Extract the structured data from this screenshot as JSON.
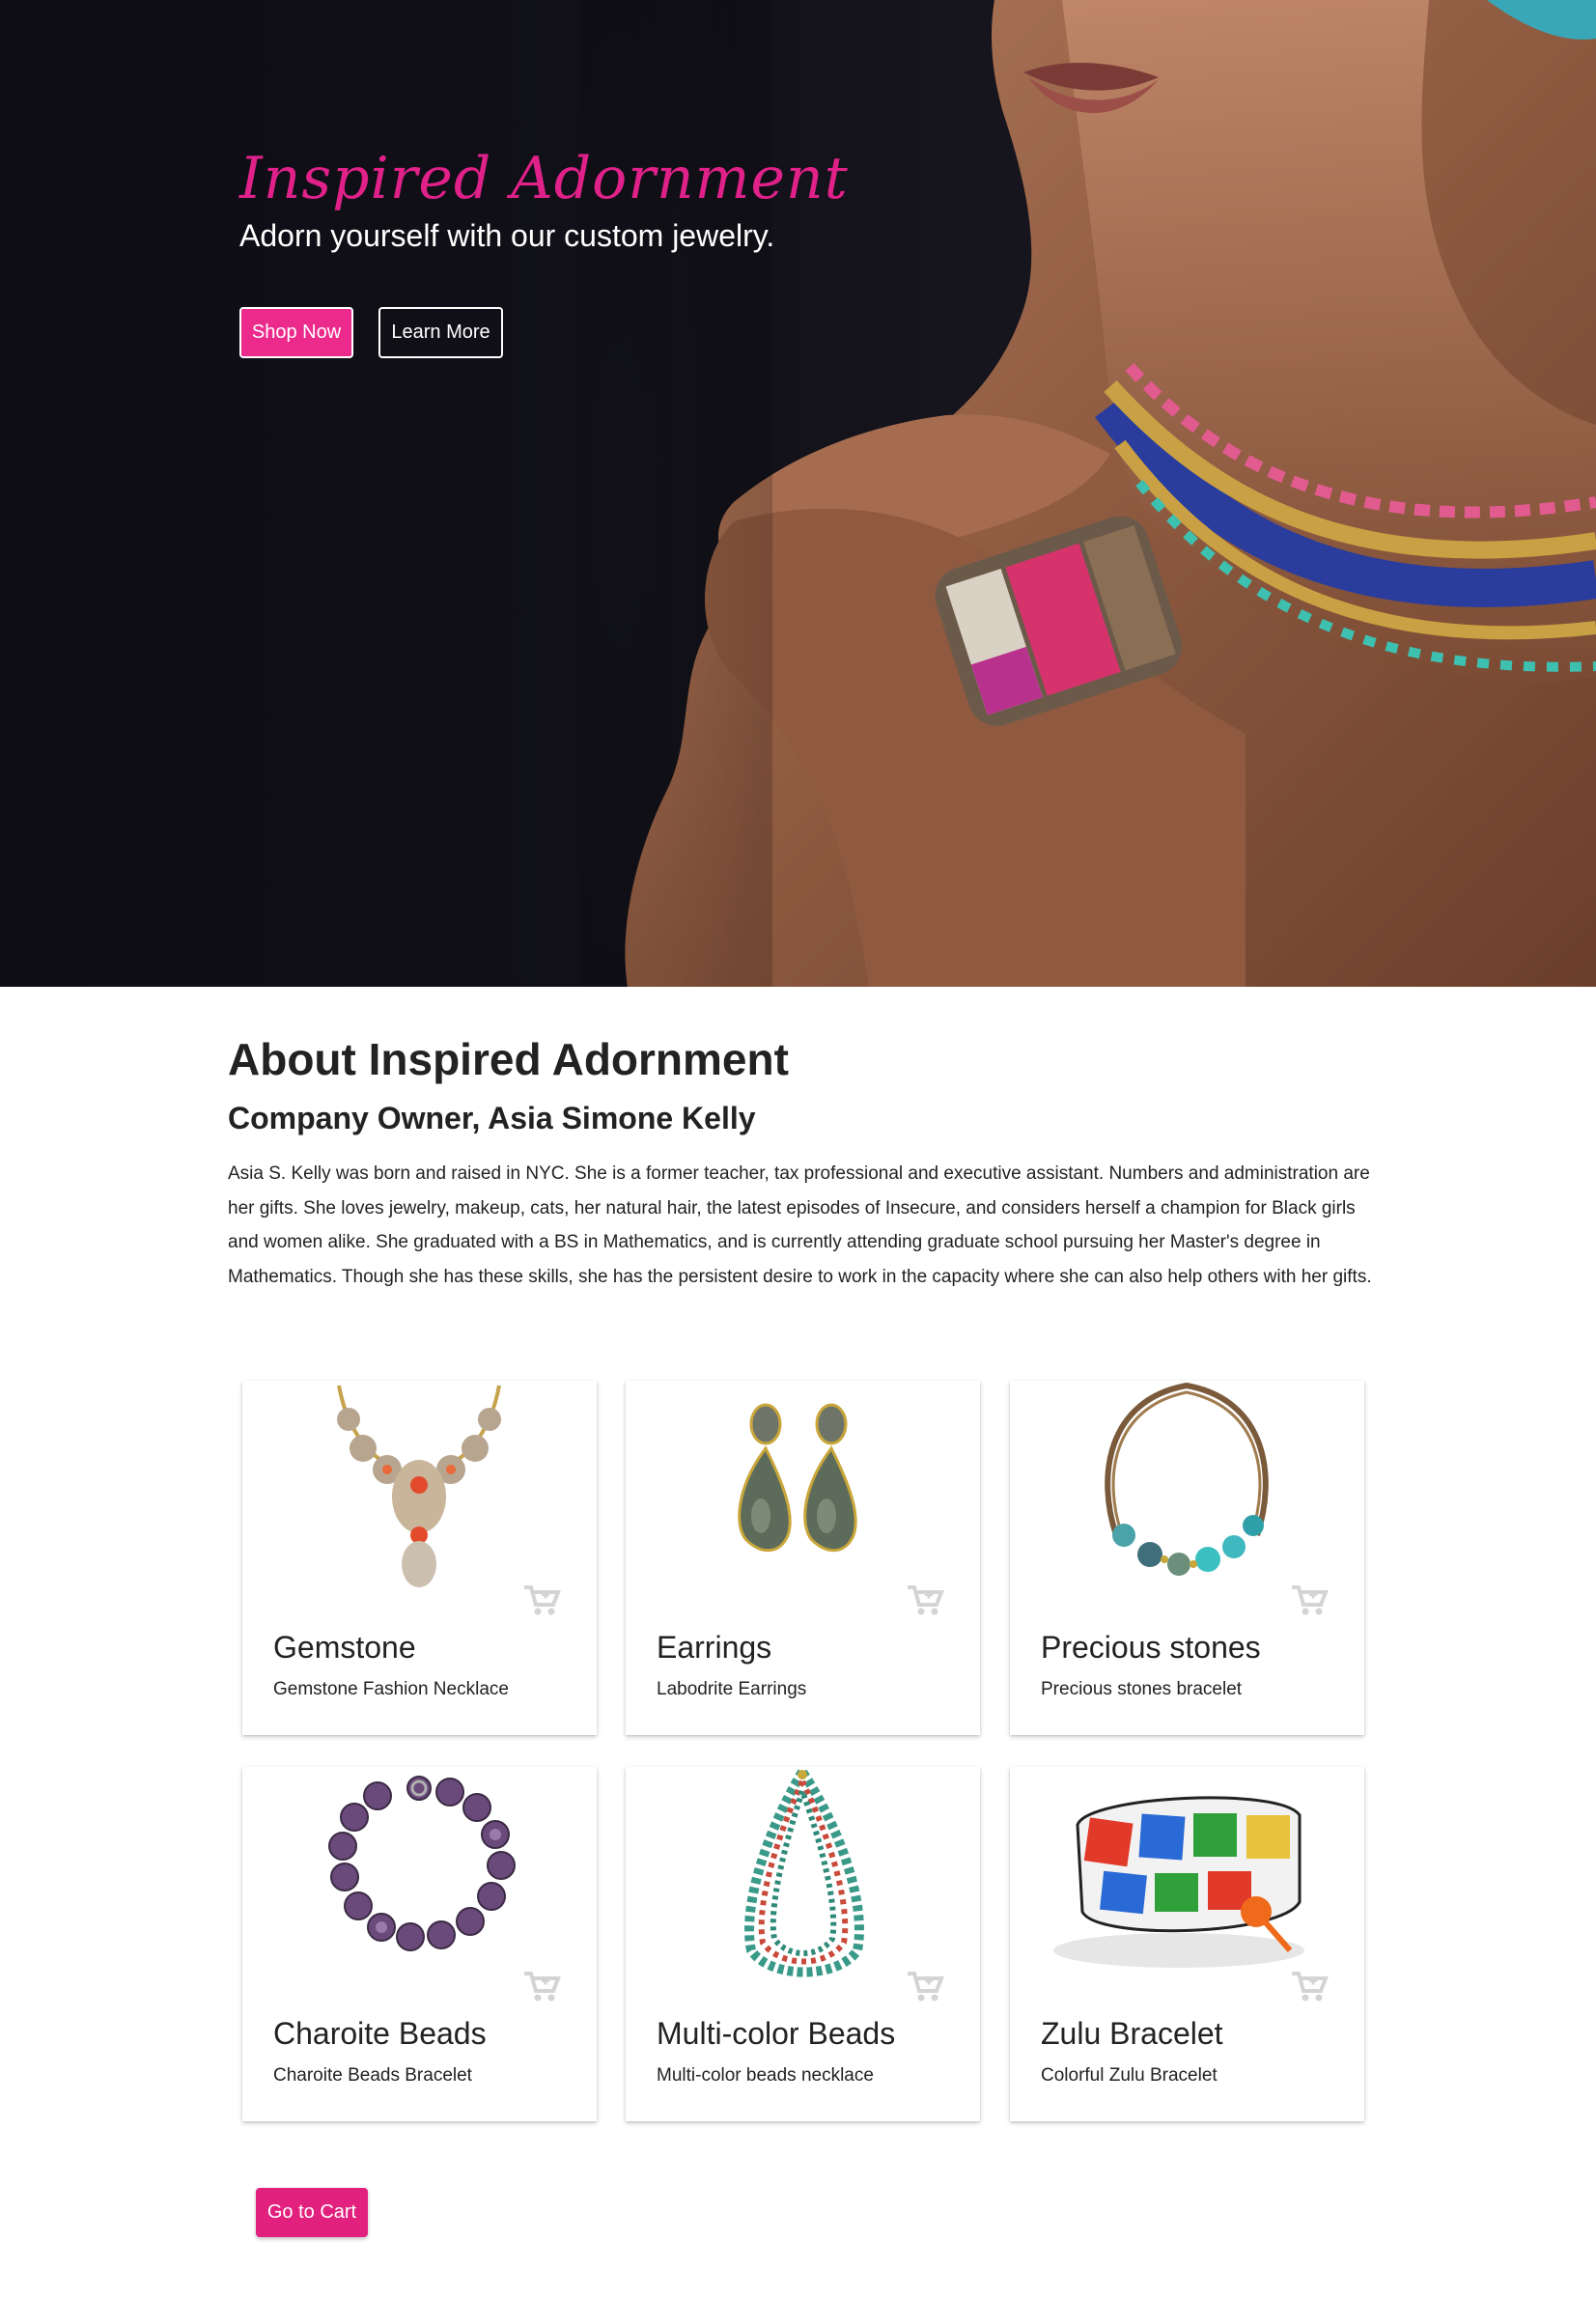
{
  "hero": {
    "title": "Inspired Adornment",
    "subtitle": "Adorn yourself with our custom jewelry.",
    "shop_button": "Shop Now",
    "learn_button": "Learn More"
  },
  "about": {
    "title": "About Inspired Adornment",
    "subtitle": "Company Owner, Asia Simone Kelly",
    "body": "Asia S. Kelly was born and raised in NYC. She is a former teacher, tax professional and executive assistant. Numbers and administration are her gifts. She loves jewelry, makeup, cats, her natural hair, the latest episodes of Insecure, and considers herself a champion for Black girls and women alike. She graduated with a BS in Mathematics, and is currently attending graduate school pursuing her Master's degree in Mathematics. Though she has these skills, she has the persistent desire to work in the capacity where she can also help others with her gifts."
  },
  "products": [
    {
      "title": "Gemstone",
      "description": "Gemstone Fashion Necklace"
    },
    {
      "title": "Earrings",
      "description": "Labodrite Earrings"
    },
    {
      "title": "Precious stones",
      "description": "Precious stones bracelet"
    },
    {
      "title": "Charoite Beads",
      "description": "Charoite Beads Bracelet"
    },
    {
      "title": "Multi-color Beads",
      "description": "Multi-color beads necklace"
    },
    {
      "title": "Zulu Bracelet",
      "description": "Colorful Zulu Bracelet"
    }
  ],
  "cart_button": "Go to Cart",
  "colors": {
    "accent": "#ec2a8c",
    "hero_background": "#111018",
    "text": "#222222",
    "cart_icon": "#d4d4d4"
  },
  "icons": [
    "shopping-cart-icon"
  ]
}
